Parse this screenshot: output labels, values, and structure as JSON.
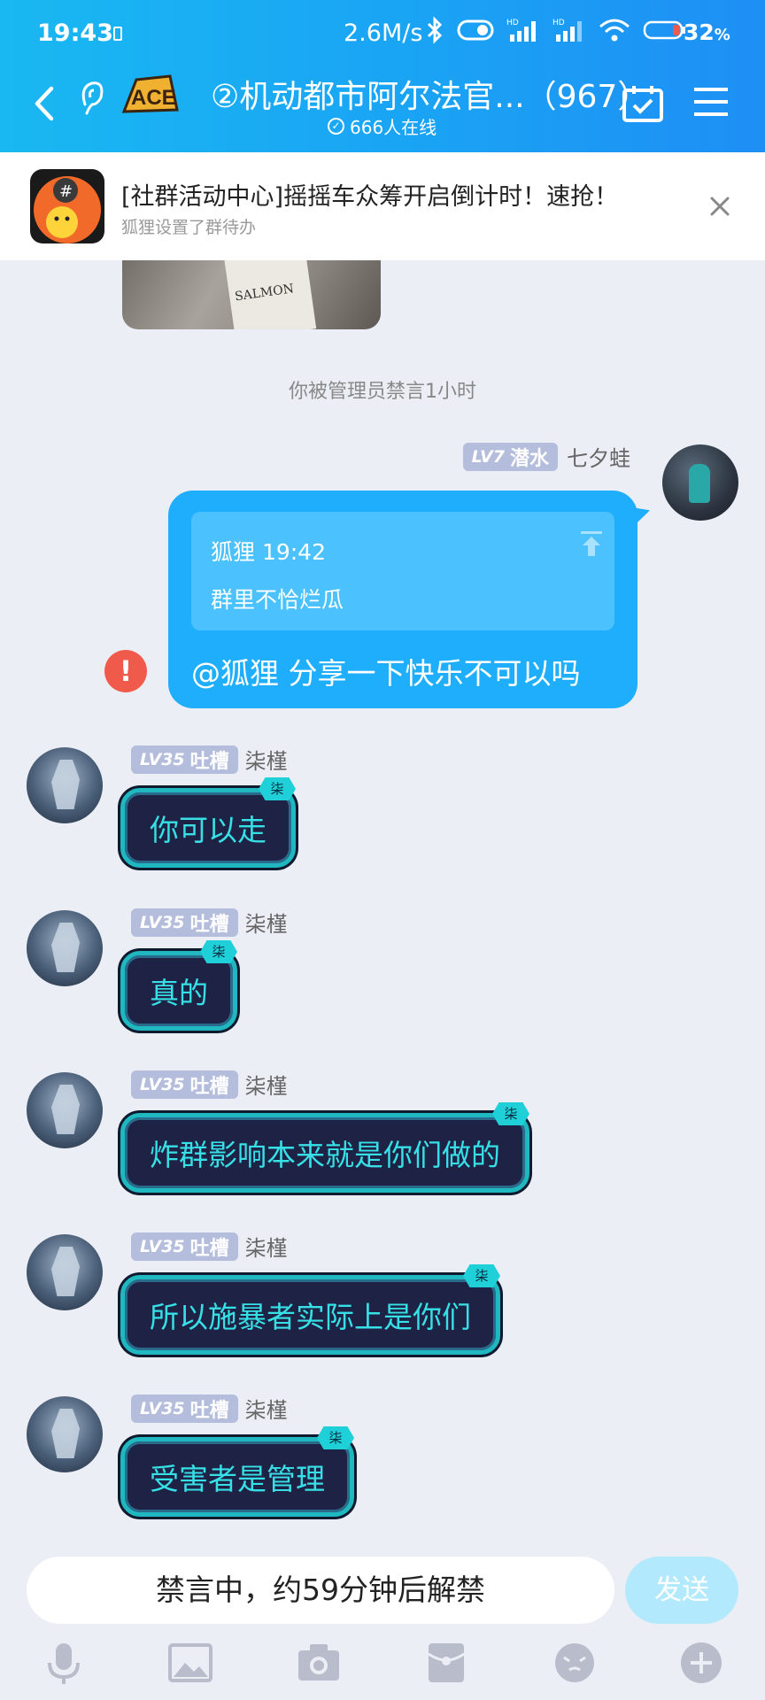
{
  "status_bar": {
    "time": "19:43",
    "speed": "2.6M/s",
    "battery": "32",
    "battery_unit": "%"
  },
  "header": {
    "title": "②机动都市阿尔法官...（967）",
    "logo_text": "ACE",
    "online": "666人在线"
  },
  "notice": {
    "title": "[社群活动中心]摇摇车众筹开启倒计时！速抢！",
    "subtitle": "狐狸设置了群待办",
    "icon_glyph": "#"
  },
  "chat": {
    "system_message": "你被管理员禁言1小时",
    "prev_image_text": "SALMON",
    "me": {
      "level": "LV7",
      "title": "潜水",
      "nickname": "七夕蛙",
      "quote_author_time": "狐狸 19:42",
      "quote_text": "群里不恰烂瓜",
      "text": "@狐狸 分享一下快乐不可以吗",
      "failed_icon": "!"
    },
    "messages": [
      {
        "level": "LV35",
        "title": "吐槽",
        "nickname": "柒槿",
        "tag": "柒",
        "text": "你可以走"
      },
      {
        "level": "LV35",
        "title": "吐槽",
        "nickname": "柒槿",
        "tag": "柒",
        "text": "真的"
      },
      {
        "level": "LV35",
        "title": "吐槽",
        "nickname": "柒槿",
        "tag": "柒",
        "text": "炸群影响本来就是你们做的"
      },
      {
        "level": "LV35",
        "title": "吐槽",
        "nickname": "柒槿",
        "tag": "柒",
        "text": "所以施暴者实际上是你们"
      },
      {
        "level": "LV35",
        "title": "吐槽",
        "nickname": "柒槿",
        "tag": "柒",
        "text": "受害者是管理"
      }
    ]
  },
  "input": {
    "muted_text": "禁言中，约59分钟后解禁",
    "send_label": "发送"
  },
  "colors": {
    "header_start": "#19b8f2",
    "header_end": "#1e8ff5",
    "my_bubble": "#1eaefc",
    "fancy_bubble_bg": "#1e2244",
    "fancy_bubble_text": "#37e0e6",
    "fail": "#f05a4a"
  },
  "icons": [
    "back-arrow-icon",
    "ear-icon",
    "checkin-icon",
    "menu-icon",
    "close-icon",
    "jump-to-icon",
    "mic-icon",
    "image-icon",
    "camera-icon",
    "red-packet-icon",
    "emoji-icon",
    "plus-icon"
  ]
}
